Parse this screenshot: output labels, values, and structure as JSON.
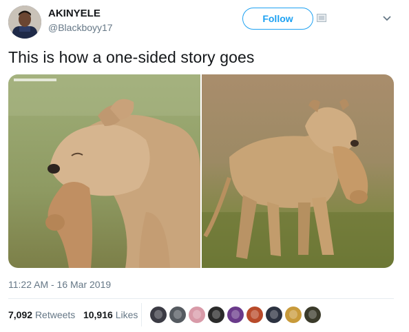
{
  "user": {
    "display_name": "AKINYELE",
    "handle": "@Blackboyy17",
    "avatar_icon": "profile-avatar"
  },
  "header": {
    "follow_label": "Follow",
    "chevron_icon": "chevron-down-icon"
  },
  "tweet": {
    "text": "This is how a one-sided story goes",
    "timestamp": "11:22 AM - 16 Mar 2019"
  },
  "media": {
    "images": [
      {
        "description_icon": "lioness-closeup-photo"
      },
      {
        "description_icon": "lioness-walking-photo"
      }
    ]
  },
  "stats": {
    "retweets_count": "7,092",
    "retweets_label": "Retweets",
    "likes_count": "10,916",
    "likes_label": "Likes"
  },
  "likers": {
    "count": 10,
    "colors": [
      "#3b3b44",
      "#555a60",
      "#d89aa8",
      "#2a2a2a",
      "#6a3a8a",
      "#b84a2a",
      "#2c3240",
      "#c89a3a",
      "#3a3a2a"
    ]
  }
}
